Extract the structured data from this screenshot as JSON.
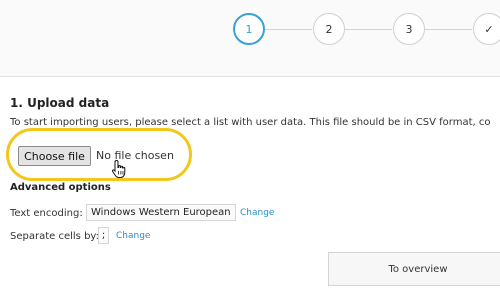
{
  "stepper": {
    "steps": [
      {
        "label": "1",
        "state": "active"
      },
      {
        "label": "2",
        "state": "pending"
      },
      {
        "label": "3",
        "state": "pending"
      },
      {
        "label": "✓",
        "state": "pending"
      }
    ],
    "active_color": "#3aa0d5"
  },
  "upload": {
    "title": "1. Upload data",
    "intro": "To start importing users, please select a list with user data. This file should be in CSV format, co",
    "choose_file_label": "Choose file",
    "file_status": "No file chosen",
    "highlight_color": "#f2c71c"
  },
  "advanced": {
    "title": "Advanced options",
    "encoding_label": "Text encoding:",
    "encoding_value": "Windows Western European",
    "separator_label": "Separate cells by:",
    "separator_value": ";",
    "change_label": "Change",
    "link_color": "#2a8fc8"
  },
  "footer": {
    "overview_label": "To overview"
  },
  "icons": {
    "cursor": "hand-pointer-icon"
  }
}
